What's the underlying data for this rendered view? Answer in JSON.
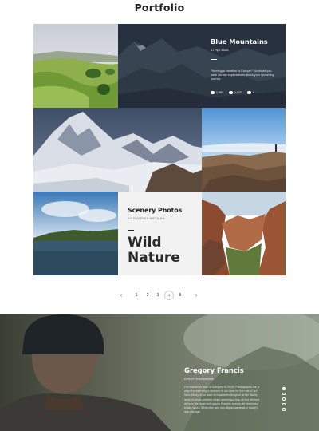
{
  "page_title": "Portfolio",
  "featured": {
    "title": "Blue Mountains",
    "date": "17 Apr 2018",
    "description": "Planning a vacation to Europe? No doubt you have certain expectations about your upcoming journey",
    "stats": {
      "views": "1,563",
      "likes": "1,873",
      "comments": "8"
    }
  },
  "scenery": {
    "title": "Scenery Photos",
    "byline": "BY EVGENIY METILAN",
    "big_text": "Wild Nature"
  },
  "pagination": {
    "prev": "‹",
    "pages": [
      "1",
      "2",
      "3",
      "4",
      "5"
    ],
    "active_index": 3,
    "next": "›"
  },
  "testimonial": {
    "name": "Gregory Francis",
    "role": "CHIEF ENGINEER",
    "text": "I’ve started to work in company in 2005. Photographs are a way of preserving a moment in our lives for the rest of our lives. Many of us have at least been tempted at the flashy array of photo printers which seemingly leap off the shelves at even the least tech-savvy. It surely seems old fashioned to talk about 35mm film and non-digital cameras in today’s day and age.",
    "slider_dots": 5,
    "active_dot": 0
  }
}
